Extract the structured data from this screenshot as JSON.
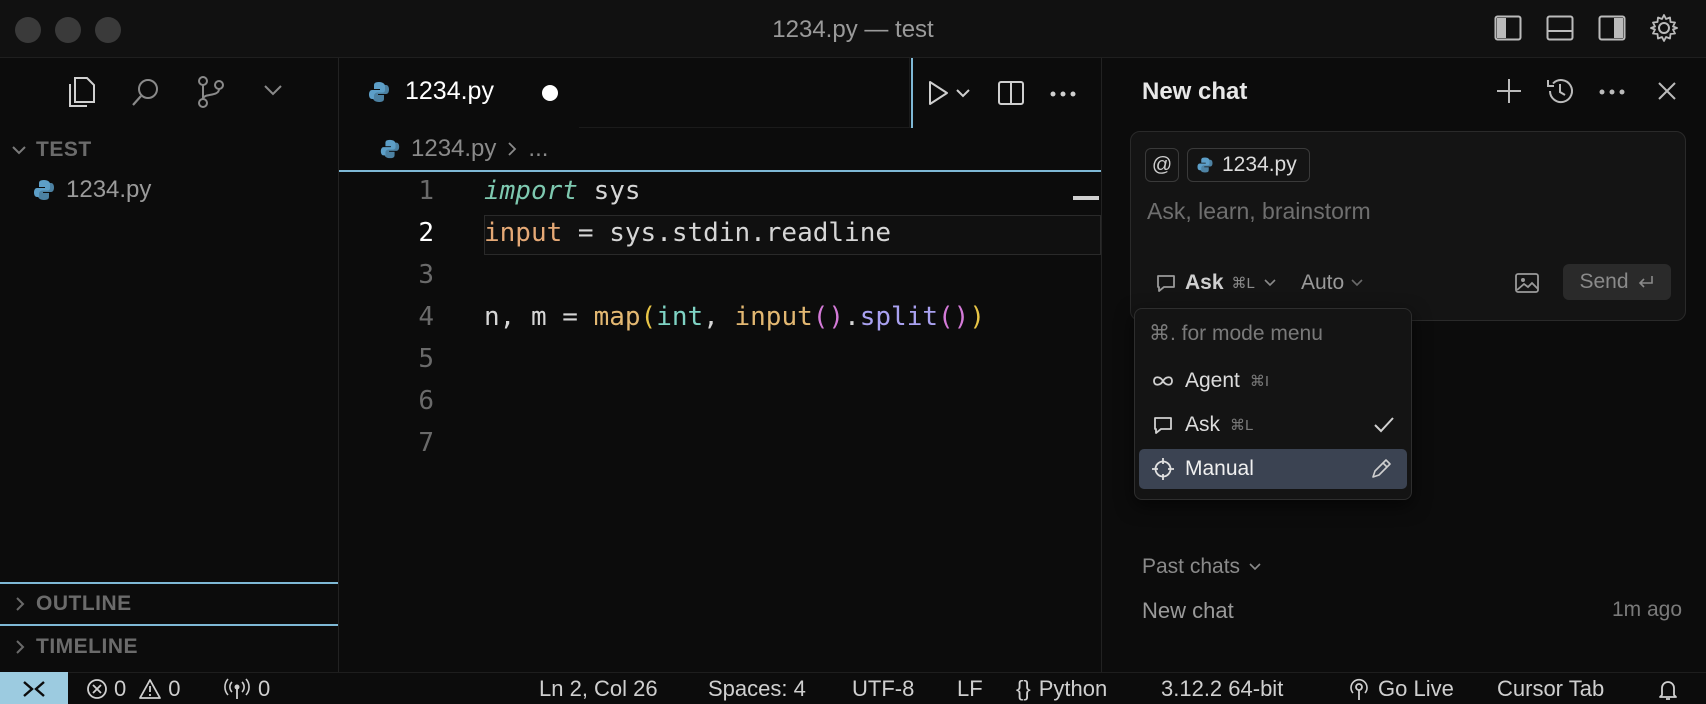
{
  "window": {
    "title": "1234.py — test"
  },
  "sidebar": {
    "section_title": "TEST",
    "files": [
      {
        "name": "1234.py"
      }
    ],
    "panels": [
      {
        "label": "OUTLINE"
      },
      {
        "label": "TIMELINE"
      }
    ]
  },
  "editor": {
    "tab": {
      "filename": "1234.py"
    },
    "breadcrumb": {
      "file": "1234.py",
      "rest": "..."
    },
    "active_line": "2",
    "line_numbers": [
      "1",
      "2",
      "3",
      "4",
      "5",
      "6",
      "7"
    ],
    "code": {
      "l1": {
        "kw": "import",
        "rest": " sys"
      },
      "l2": {
        "var": "input",
        "rest": " = sys.stdin.readline"
      },
      "l4": {
        "a": "n, m = ",
        "map": "map",
        "p1": "(",
        "int": "int",
        "comma": ", ",
        "input": "input",
        "p2": "()",
        "dot": ".",
        "split": "split",
        "p3": "()",
        "p4": ")"
      }
    }
  },
  "chat": {
    "title": "New chat",
    "context_chip": {
      "at": "@",
      "file": "1234.py"
    },
    "input_placeholder": "Ask, learn, brainstorm",
    "mode": {
      "label": "Ask",
      "shortcut": "⌘L"
    },
    "model": "Auto",
    "send_label": "Send",
    "mode_menu": {
      "hint": "⌘. for mode menu",
      "items": [
        {
          "label": "Agent",
          "shortcut": "⌘I"
        },
        {
          "label": "Ask",
          "shortcut": "⌘L"
        },
        {
          "label": "Manual",
          "shortcut": ""
        }
      ]
    },
    "past_chats": {
      "label": "Past chats",
      "items": [
        {
          "title": "New chat",
          "time": "1m ago"
        }
      ]
    }
  },
  "statusbar": {
    "errors": "0",
    "warnings": "0",
    "ports": "0",
    "position": "Ln 2, Col 26",
    "spaces": "Spaces: 4",
    "encoding": "UTF-8",
    "eol": "LF",
    "language": "Python",
    "interpreter": "3.12.2 64-bit",
    "go_live": "Go Live",
    "cursor_tab": "Cursor Tab"
  },
  "colors": {
    "keyword": "#7ec9b0",
    "variable": "#e5a976",
    "function": "#e3b872",
    "builtin": "#7fd3c4",
    "method": "#a9a1f0",
    "bracket_paren": "#d47ad8",
    "bracket_outer": "#e8c547",
    "accent_border": "#7fb9d6",
    "remote_bg": "#9ccbe0"
  }
}
